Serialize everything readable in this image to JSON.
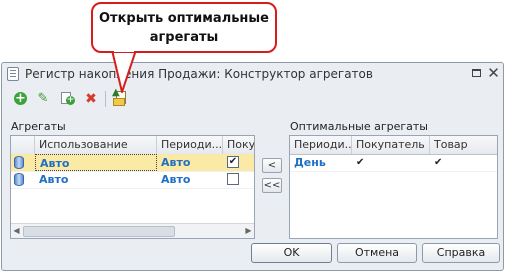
{
  "callout": {
    "line1": "Открыть оптимальные",
    "line2": "агрегаты"
  },
  "window": {
    "title": "Регистр накопления Продажи: Конструктор агрегатов"
  },
  "toolbar": {
    "add_icon": "add-icon",
    "edit_icon": "edit-icon",
    "copy_icon": "copy-icon",
    "delete_icon": "delete-icon",
    "open_optimal_icon": "open-optimal-aggregates-icon"
  },
  "left_panel": {
    "label": "Агрегаты",
    "columns": [
      "Использование",
      "Периоди...",
      "Покупат"
    ],
    "rows": [
      {
        "usage": "Авто",
        "period": "Авто",
        "checked": true,
        "selected": true
      },
      {
        "usage": "Авто",
        "period": "Авто",
        "checked": false,
        "selected": false
      }
    ]
  },
  "move_buttons": {
    "move_one": "<",
    "move_all": "<<"
  },
  "right_panel": {
    "label": "Оптимальные агрегаты",
    "columns": [
      "Периоди...",
      "Покупатель",
      "Товар"
    ],
    "rows": [
      {
        "period": "День",
        "buyer": "✔",
        "product": "✔"
      }
    ]
  },
  "buttons": {
    "ok": "OK",
    "cancel": "Отмена",
    "help": "Справка"
  },
  "colors": {
    "callout_border": "#d81c1c",
    "link_blue": "#1f6fc5",
    "selection": "#fbeaa6"
  }
}
